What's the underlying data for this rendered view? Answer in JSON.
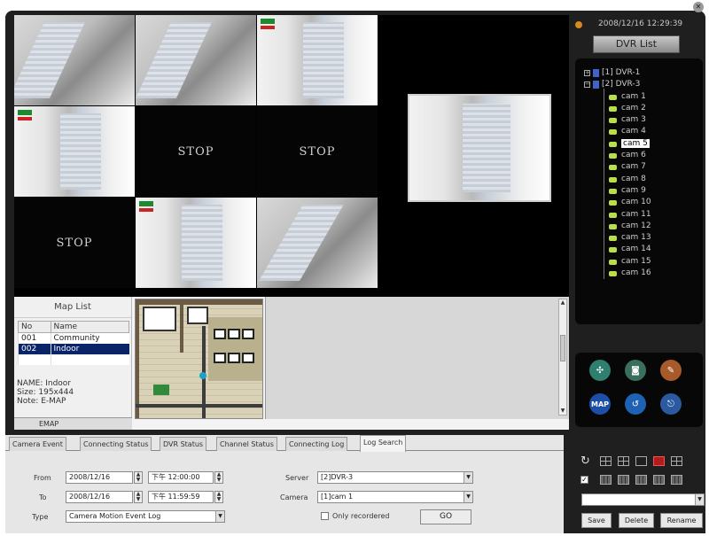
{
  "grid": {
    "stop_label": "STOP"
  },
  "map": {
    "title": "Map List",
    "columns": [
      "No",
      "Name"
    ],
    "rows": [
      {
        "no": "001",
        "name": "Community"
      },
      {
        "no": "002",
        "name": "Indoor"
      }
    ],
    "info_name": "NAME: Indoor",
    "info_size": "Size: 195x444",
    "info_note": "Note: E-MAP",
    "tab_label": "EMAP"
  },
  "dvr": {
    "clock": "2008/12/16 12:29:39",
    "header": "DVR List",
    "servers": [
      "[1] DVR-1",
      "[2] DVR-3"
    ],
    "cameras": [
      "cam 1",
      "cam 2",
      "cam 3",
      "cam 4",
      "cam 5",
      "cam 6",
      "cam 7",
      "cam 8",
      "cam 9",
      "cam 10",
      "cam 11",
      "cam 12",
      "cam 13",
      "cam 14",
      "cam 15",
      "cam 16"
    ],
    "selected_camera": "cam 5",
    "map_icon_label": "MAP"
  },
  "tabs": [
    "Camera Event",
    "Connecting Status",
    "DVR Status",
    "Channel Status",
    "Connecting Log",
    "Log Search"
  ],
  "active_tab": "Log Search",
  "search": {
    "from_label": "From",
    "from_date": "2008/12/16",
    "from_time": "下午 12:00:00",
    "to_label": "To",
    "to_date": "2008/12/16",
    "to_time": "下午 11:59:59",
    "type_label": "Type",
    "type_value": "Camera Motion Event Log",
    "server_label": "Server",
    "server_value": "[2]DVR-3",
    "camera_label": "Camera",
    "camera_value": "[1]cam 1",
    "only_label": "Only recordered",
    "go_label": "GO"
  },
  "layout": {
    "save_label": "Save",
    "delete_label": "Delete",
    "rename_label": "Rename"
  },
  "colors": {
    "selection_orange": "#e0913b",
    "highlight_blue": "#0a246a",
    "cam_green": "#b8e04a"
  }
}
